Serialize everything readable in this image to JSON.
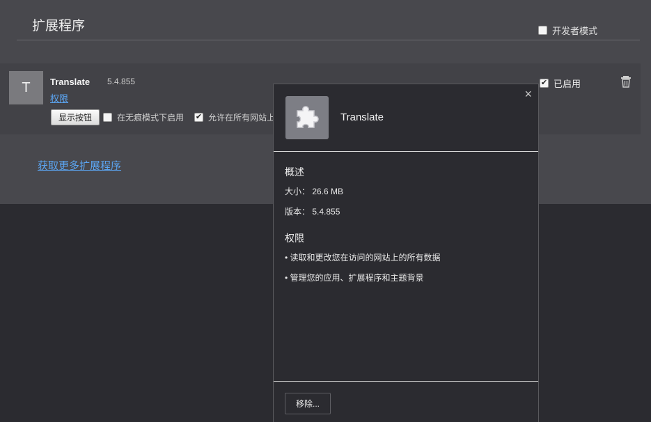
{
  "page": {
    "title": "扩展程序",
    "devmode_label": "开发者模式",
    "get_more_link": "获取更多扩展程序"
  },
  "extension": {
    "avatar_letter": "T",
    "name": "Translate",
    "version": "5.4.855",
    "permissions_link": "权限",
    "show_button": "显示按钮",
    "incognito_label": "在无痕模式下启用",
    "allsites_label": "允许在所有网站上",
    "enabled_label": "已启用",
    "enabled_checked": "✔",
    "allsites_checked": "✔"
  },
  "dialog": {
    "close_glyph": "×",
    "title": "Translate",
    "overview_heading": "概述",
    "size_line": "大小： 26.6 MB",
    "version_line": "版本： 5.4.855",
    "permissions_heading": "权限",
    "permissions": [
      "• 读取和更改您在访问的网站上的所有数据",
      "• 管理您的应用、扩展程序和主题背景"
    ],
    "remove_button": "移除..."
  },
  "colors": {
    "link": "#5ba4f0",
    "top_bg": "#48484d",
    "dark_bg": "#2b2b30"
  },
  "icons": [
    "puzzle-icon",
    "trash-icon",
    "close-icon"
  ]
}
